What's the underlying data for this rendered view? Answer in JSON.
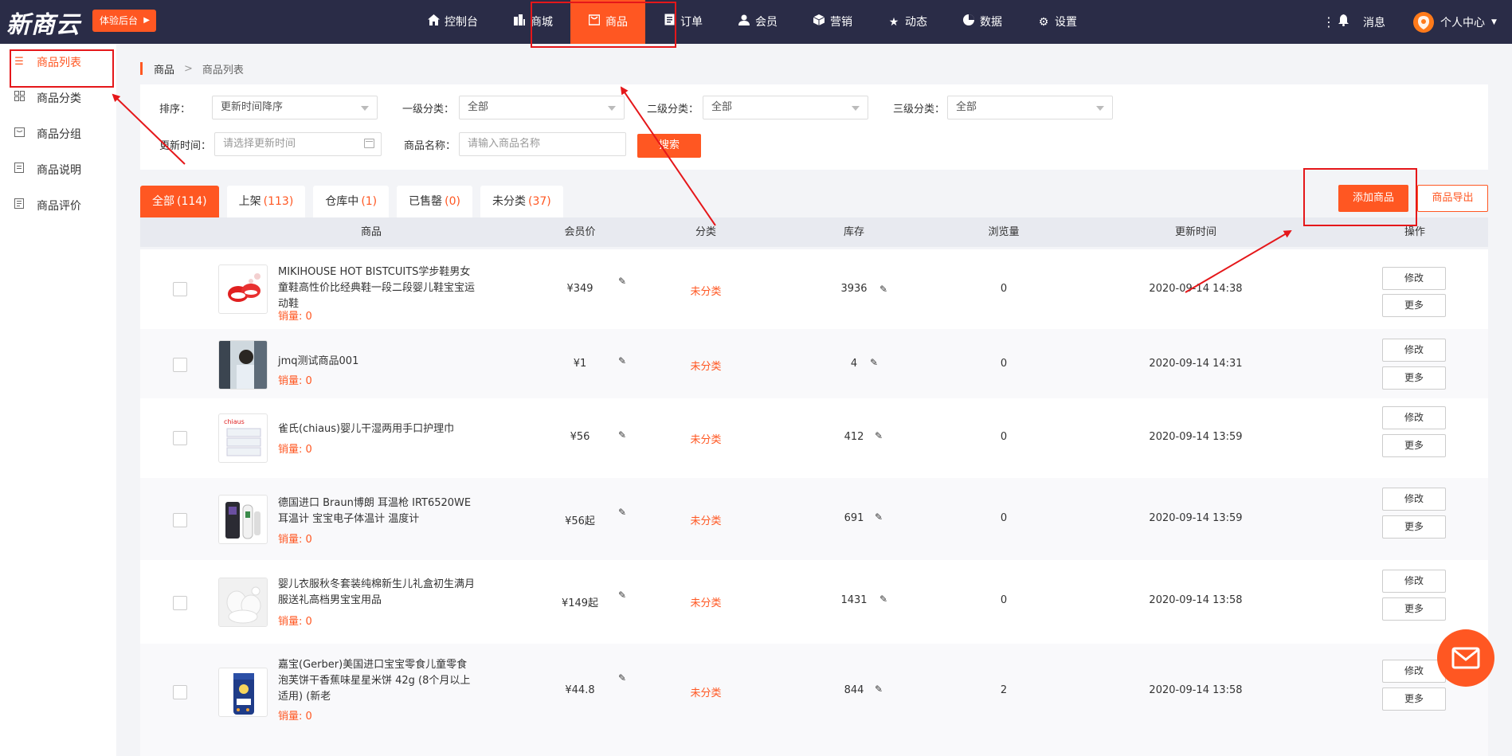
{
  "topbar": {
    "logo": "新商云",
    "try_button": "体验后台",
    "nav": [
      {
        "label": "控制台",
        "icon": "home-icon"
      },
      {
        "label": "商城",
        "icon": "mall-icon"
      },
      {
        "label": "商品",
        "icon": "bag-icon"
      },
      {
        "label": "订单",
        "icon": "order-icon"
      },
      {
        "label": "会员",
        "icon": "user-icon"
      },
      {
        "label": "营销",
        "icon": "box-icon"
      },
      {
        "label": "动态",
        "icon": "star-icon"
      },
      {
        "label": "数据",
        "icon": "pie-icon"
      },
      {
        "label": "设置",
        "icon": "gear-icon"
      }
    ],
    "active_nav": "商品",
    "messages": "消息",
    "personal": "个人中心"
  },
  "sidebar": {
    "items": [
      {
        "label": "商品列表",
        "icon": "list-icon"
      },
      {
        "label": "商品分类",
        "icon": "grid-icon"
      },
      {
        "label": "商品分组",
        "icon": "group-icon"
      },
      {
        "label": "商品说明",
        "icon": "doc-icon"
      },
      {
        "label": "商品评价",
        "icon": "review-icon"
      }
    ],
    "active": "商品列表"
  },
  "breadcrumb": {
    "root": "商品",
    "separator": ">",
    "current": "商品列表"
  },
  "filters": {
    "sort_label": "排序：",
    "sort_value": "更新时间降序",
    "cat1_label": "一级分类：",
    "cat1_value": "全部",
    "cat2_label": "二级分类：",
    "cat2_value": "全部",
    "cat3_label": "三级分类：",
    "cat3_value": "全部",
    "time_label": "更新时间：",
    "time_placeholder": "请选择更新时间",
    "name_label": "商品名称：",
    "name_placeholder": "请输入商品名称",
    "search_button": "搜索"
  },
  "tabs": [
    {
      "label": "全部",
      "count": "(114)"
    },
    {
      "label": "上架",
      "count": "(113)"
    },
    {
      "label": "仓库中",
      "count": "(1)"
    },
    {
      "label": "已售罄",
      "count": "(0)"
    },
    {
      "label": "未分类",
      "count": "(37)"
    }
  ],
  "active_tab": "全部",
  "actions": {
    "add": "添加商品",
    "export": "商品导出"
  },
  "table": {
    "headers": [
      "商品",
      "会员价",
      "分类",
      "库存",
      "浏览量",
      "更新时间",
      "操作"
    ],
    "rows": [
      {
        "name": "MIKIHOUSE HOT BISTCUITS学步鞋男女童鞋高性价比经典鞋一段二段婴儿鞋宝宝运动鞋",
        "sales": "销量: 0",
        "price": "¥349",
        "category": "未分类",
        "stock": "3936",
        "views": "0",
        "updated": "2020-09-14 14:38",
        "thumb": "shoes"
      },
      {
        "name": "jmq测试商品001",
        "sales": "销量: 0",
        "price": "¥1",
        "category": "未分类",
        "stock": "4",
        "views": "0",
        "updated": "2020-09-14 14:31",
        "thumb": "photo"
      },
      {
        "name": "雀氏(chiaus)婴儿干湿两用手口护理巾",
        "sales": "销量: 0",
        "price": "¥56",
        "category": "未分类",
        "stock": "412",
        "views": "0",
        "updated": "2020-09-14 13:59",
        "thumb": "wipes"
      },
      {
        "name": "德国进口 Braun博朗 耳温枪 IRT6520WE 耳温计 宝宝电子体温计 温度计",
        "sales": "销量: 0",
        "price": "¥56起",
        "category": "未分类",
        "stock": "691",
        "views": "0",
        "updated": "2020-09-14 13:59",
        "thumb": "thermo"
      },
      {
        "name": "婴儿衣服秋冬套装纯棉新生儿礼盒初生满月服送礼高档男宝宝用品",
        "sales": "销量: 0",
        "price": "¥149起",
        "category": "未分类",
        "stock": "1431",
        "views": "0",
        "updated": "2020-09-14 13:58",
        "thumb": "clothes"
      },
      {
        "name": "嘉宝(Gerber)美国进口宝宝零食儿童零食泡芙饼干香蕉味星星米饼 42g (8个月以上适用) (新老",
        "sales": "销量: 0",
        "price": "¥44.8",
        "category": "未分类",
        "stock": "844",
        "views": "2",
        "updated": "2020-09-14 13:58",
        "thumb": "snack"
      }
    ],
    "edit_button": "修改",
    "more_button": "更多"
  },
  "colors": {
    "accent": "#ff5722",
    "topbar": "#2a2c47",
    "annotation": "#e5171a"
  }
}
